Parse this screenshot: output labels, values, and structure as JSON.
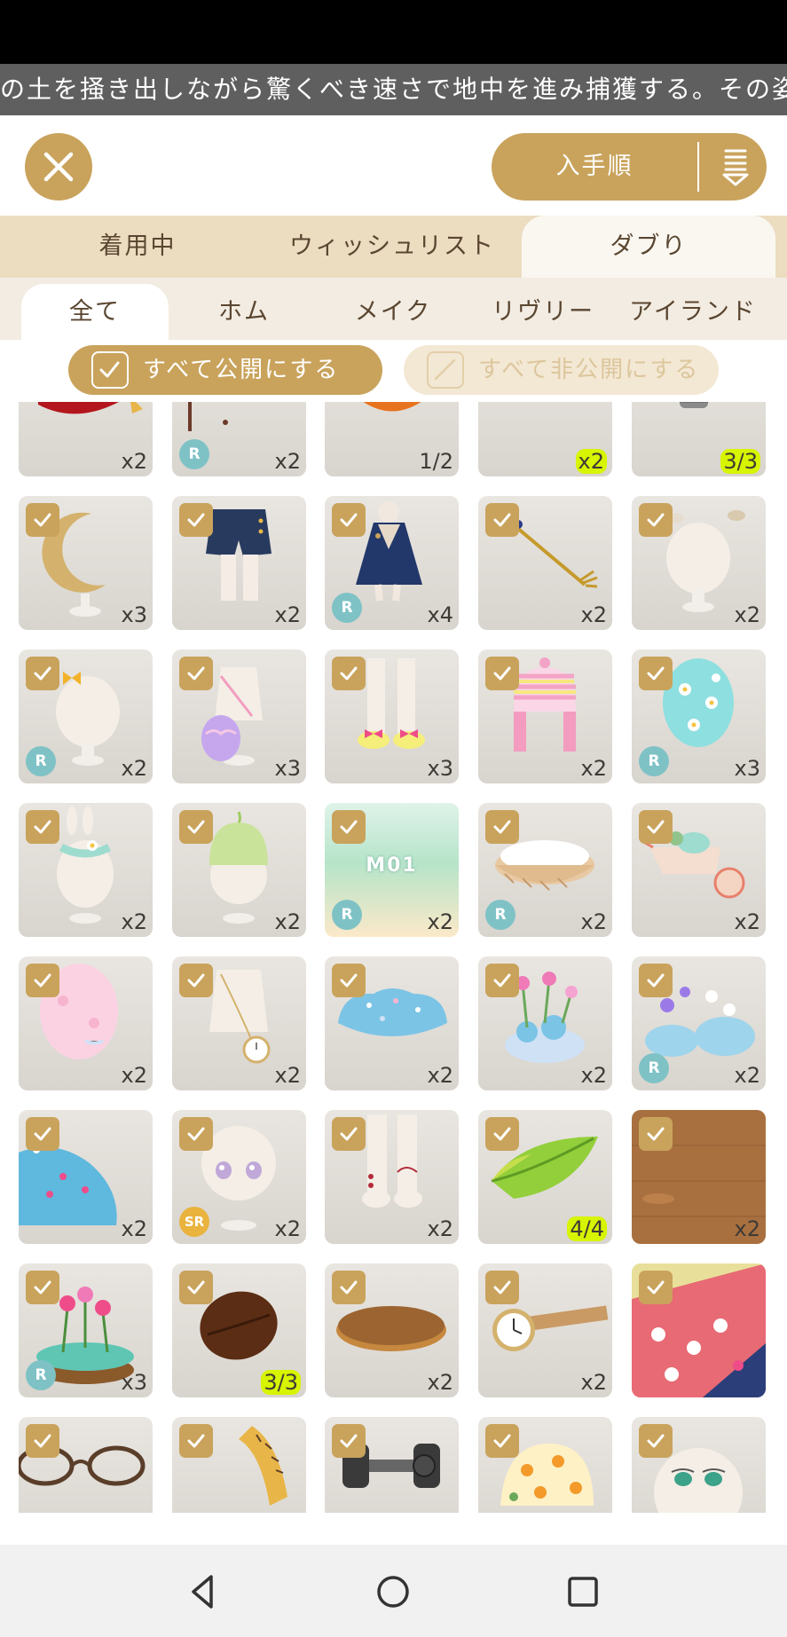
{
  "marquee": {
    "text": "の土を掻き出しながら驚くべき速さで地中を進み捕獲する。その姿から"
  },
  "header": {
    "sort_label": "入手順"
  },
  "tabs_primary": [
    {
      "label": "着用中",
      "active": false
    },
    {
      "label": "ウィッシュリスト",
      "active": false
    },
    {
      "label": "ダブり",
      "active": true
    }
  ],
  "tabs_secondary": [
    {
      "label": "全て",
      "active": true
    },
    {
      "label": "ホム",
      "active": false
    },
    {
      "label": "メイク",
      "active": false
    },
    {
      "label": "リヴリー",
      "active": false
    },
    {
      "label": "アイランド",
      "active": false
    }
  ],
  "filters": {
    "public_all": "すべて公開にする",
    "private_all": "すべて非公開にする"
  },
  "items": [
    {
      "icon": "red-cushion",
      "badge": "",
      "count": "x2",
      "checked": false,
      "highlight": false
    },
    {
      "icon": "potion-stand",
      "badge": "R",
      "count": "x2",
      "checked": false,
      "highlight": false
    },
    {
      "icon": "crown-lamp",
      "badge": "",
      "count": "1/2",
      "checked": false,
      "highlight": false
    },
    {
      "icon": "gold-coins",
      "badge": "",
      "count": "x2",
      "checked": false,
      "highlight": true
    },
    {
      "icon": "light-bulb",
      "badge": "",
      "count": "3/3",
      "checked": false,
      "highlight": true
    },
    {
      "icon": "crescent-moon",
      "badge": "",
      "count": "x3",
      "checked": true,
      "highlight": false
    },
    {
      "icon": "navy-shorts",
      "badge": "",
      "count": "x2",
      "checked": true,
      "highlight": false
    },
    {
      "icon": "blue-dress",
      "badge": "R",
      "count": "x4",
      "checked": true,
      "highlight": false
    },
    {
      "icon": "star-wand",
      "badge": "",
      "count": "x2",
      "checked": true,
      "highlight": false
    },
    {
      "icon": "hair-clips",
      "badge": "",
      "count": "x2",
      "checked": true,
      "highlight": false
    },
    {
      "icon": "hair-bow",
      "badge": "R",
      "count": "x2",
      "checked": true,
      "highlight": false
    },
    {
      "icon": "egg-bag",
      "badge": "",
      "count": "x3",
      "checked": true,
      "highlight": false
    },
    {
      "icon": "bow-socks",
      "badge": "",
      "count": "x3",
      "checked": true,
      "highlight": false
    },
    {
      "icon": "striped-hat",
      "badge": "",
      "count": "x2",
      "checked": true,
      "highlight": false
    },
    {
      "icon": "flower-egg",
      "badge": "R",
      "count": "x3",
      "checked": true,
      "highlight": false
    },
    {
      "icon": "bunny-collar",
      "badge": "",
      "count": "x2",
      "checked": true,
      "highlight": false
    },
    {
      "icon": "green-hair",
      "badge": "",
      "count": "x2",
      "checked": true,
      "highlight": false
    },
    {
      "icon": "music-card",
      "badge": "R",
      "count": "x2",
      "checked": true,
      "highlight": false,
      "card_text": "M01"
    },
    {
      "icon": "basket",
      "badge": "R",
      "count": "x2",
      "checked": true,
      "highlight": false
    },
    {
      "icon": "wheelbarrow",
      "badge": "",
      "count": "x2",
      "checked": true,
      "highlight": false
    },
    {
      "icon": "pink-egg",
      "badge": "",
      "count": "x2",
      "checked": true,
      "highlight": false
    },
    {
      "icon": "pocket-watch",
      "badge": "",
      "count": "x2",
      "checked": true,
      "highlight": false
    },
    {
      "icon": "blue-bush",
      "badge": "",
      "count": "x2",
      "checked": true,
      "highlight": false
    },
    {
      "icon": "flower-rock",
      "badge": "",
      "count": "x2",
      "checked": true,
      "highlight": false
    },
    {
      "icon": "flower-rocks",
      "badge": "R",
      "count": "x2",
      "checked": true,
      "highlight": false
    },
    {
      "icon": "blue-hill",
      "badge": "",
      "count": "x2",
      "checked": true,
      "highlight": false
    },
    {
      "icon": "eyes",
      "badge": "SR",
      "count": "x2",
      "checked": true,
      "highlight": false
    },
    {
      "icon": "white-boots",
      "badge": "",
      "count": "x2",
      "checked": true,
      "highlight": false
    },
    {
      "icon": "leaf",
      "badge": "",
      "count": "4/4",
      "checked": true,
      "highlight": true
    },
    {
      "icon": "wood-floor",
      "badge": "",
      "count": "x2",
      "checked": true,
      "highlight": false
    },
    {
      "icon": "flower-dome",
      "badge": "R",
      "count": "x3",
      "checked": true,
      "highlight": false
    },
    {
      "icon": "coffee-bean",
      "badge": "",
      "count": "3/3",
      "checked": true,
      "highlight": true
    },
    {
      "icon": "wood-disc",
      "badge": "",
      "count": "x2",
      "checked": true,
      "highlight": false
    },
    {
      "icon": "wrist-watch",
      "badge": "",
      "count": "x2",
      "checked": true,
      "highlight": false
    },
    {
      "icon": "floral-wallpaper",
      "badge": "",
      "count": "",
      "checked": true,
      "highlight": false
    },
    {
      "icon": "glasses",
      "badge": "",
      "count": "",
      "checked": true,
      "highlight": false
    },
    {
      "icon": "tape-measure",
      "badge": "",
      "count": "",
      "checked": true,
      "highlight": false
    },
    {
      "icon": "dumbbell",
      "badge": "",
      "count": "",
      "checked": true,
      "highlight": false
    },
    {
      "icon": "orange-cap",
      "badge": "",
      "count": "",
      "checked": true,
      "highlight": false
    },
    {
      "icon": "face-eyes",
      "badge": "",
      "count": "",
      "checked": true,
      "highlight": false
    }
  ],
  "colors": {
    "accent": "#c9a35c",
    "highlight": "#d7f400",
    "badge_r": "#7fc2c6",
    "badge_sr": "#e9b33d"
  }
}
